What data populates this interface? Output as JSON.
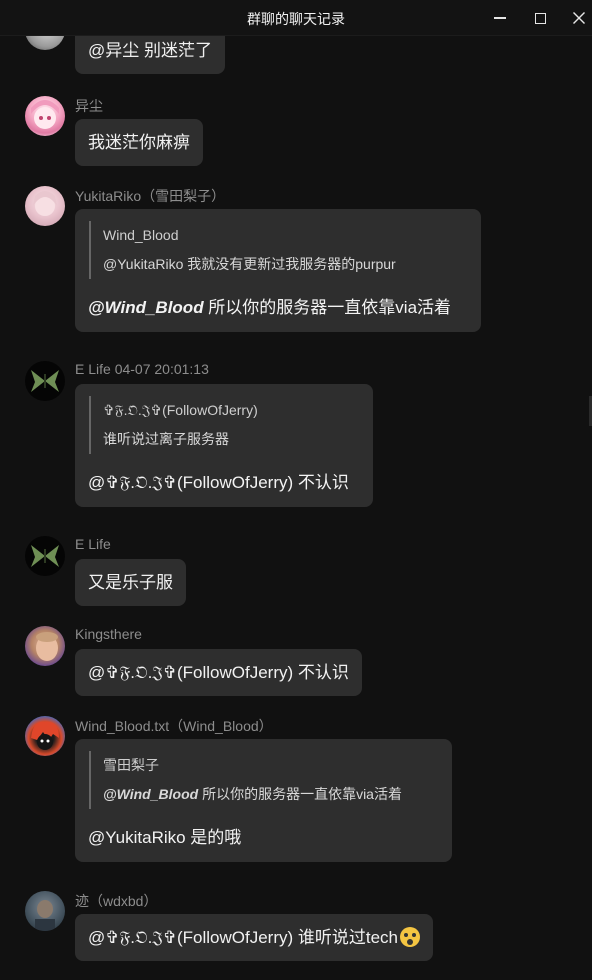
{
  "window": {
    "title": "群聊的聊天记录",
    "minimize_icon": "minimize-icon",
    "maximize_icon": "maximize-icon",
    "close_icon": "close-icon"
  },
  "messages": [
    {
      "sender": "",
      "avatar": "avatar-partial",
      "text": "@异尘 别迷茫了"
    },
    {
      "sender": "异尘",
      "avatar": "anime-girl-avatar",
      "text": "我迷茫你麻痹"
    },
    {
      "sender": "YukitaRiko（雪田梨子）",
      "avatar": "anime-girl-avatar",
      "quote": {
        "author": "Wind_Blood",
        "text": "@YukitaRiko 我就没有更新过我服务器的purpur"
      },
      "reply_mention": "@Wind_Blood",
      "reply_text": " 所以你的服务器一直依靠via活着"
    },
    {
      "sender": "E Life 04-07 20:01:13",
      "avatar": "moth-avatar",
      "quote": {
        "author": "✞𝔉.𝔒.𝔍✞(FollowOfJerry)",
        "text": "谁听说过离子服务器"
      },
      "reply_text": "@✞𝔉.𝔒.𝔍✞(FollowOfJerry) 不认识"
    },
    {
      "sender": "E Life",
      "avatar": "moth-avatar",
      "text": "又是乐子服"
    },
    {
      "sender": "Kingsthere",
      "avatar": "photo-avatar",
      "text": "@✞𝔉.𝔒.𝔍✞(FollowOfJerry) 不认识"
    },
    {
      "sender": "Wind_Blood.txt（Wind_Blood）",
      "avatar": "red-hair-avatar",
      "quote": {
        "author": "雪田梨子",
        "mention": "@Wind_Blood",
        "text": " 所以你的服务器一直依靠via活着"
      },
      "reply_text": "@YukitaRiko 是的哦"
    },
    {
      "sender": "迹（wdxbd）",
      "avatar": "photo-avatar",
      "text": "@✞𝔉.𝔒.𝔍✞(FollowOfJerry) 谁听说过tech",
      "emoji": "screaming-face-emoji"
    }
  ]
}
